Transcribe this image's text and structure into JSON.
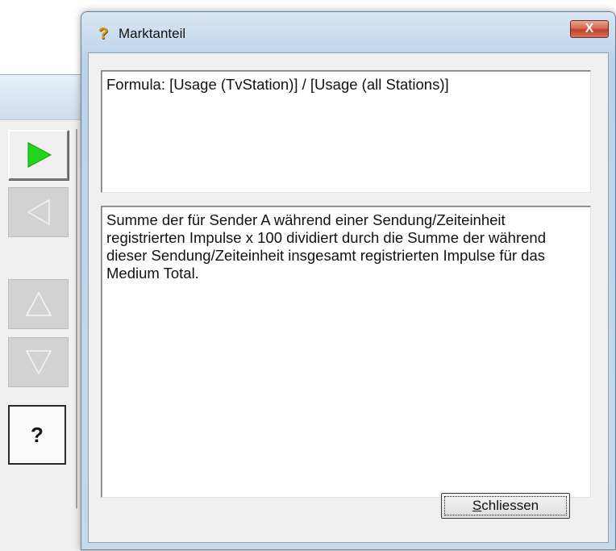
{
  "background_app": {
    "toolbar": [
      {
        "name": "play-button",
        "icon": "play-triangle-icon",
        "color": "#22d61a",
        "enabled": true
      },
      {
        "name": "back-button",
        "icon": "left-triangle-icon",
        "enabled": false
      },
      {
        "name": "up-button",
        "icon": "up-triangle-icon",
        "enabled": false
      },
      {
        "name": "down-button",
        "icon": "down-triangle-icon",
        "enabled": false
      },
      {
        "name": "help-button",
        "label": "?",
        "enabled": true
      }
    ]
  },
  "dialog": {
    "title": "Marktanteil",
    "icon": "help-question-icon",
    "close_label": "X",
    "formula": "Formula: [Usage (TvStation)] / [Usage (all Stations)]",
    "description": "Summe der für Sender A während einer Sendung/Zeiteinheit registrierten Impulse x 100 dividiert durch die Summe der während dieser Sendung/Zeiteinheit insgesamt registrierten Impulse für das Medium Total.",
    "close_button": {
      "mnemonic": "S",
      "label_rest": "chliessen"
    }
  }
}
